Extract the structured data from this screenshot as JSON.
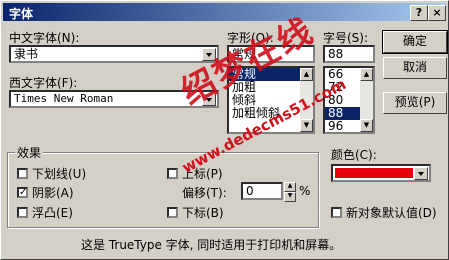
{
  "window": {
    "title": "字体",
    "help_btn": "?",
    "close_btn": "×"
  },
  "chinese_font": {
    "label": "中文字体(N):",
    "value": "隶书"
  },
  "style": {
    "label": "字形(O):",
    "value": "常规",
    "items": [
      "常规",
      "加粗",
      "倾斜",
      "加粗倾斜"
    ],
    "selected": 0
  },
  "size": {
    "label": "字号(S):",
    "value": "88",
    "items": [
      "66",
      "72",
      "80",
      "88",
      "96"
    ],
    "selected": 3
  },
  "western_font": {
    "label": "西文字体(F):",
    "value": "Times New Roman"
  },
  "buttons": {
    "ok": "确定",
    "cancel": "取消",
    "preview": "预览(P)"
  },
  "effects": {
    "label": "效果",
    "underline": "下划线(U)",
    "shadow": "阴影(A)",
    "emboss": "浮凸(E)",
    "superscript": "上标(P)",
    "offset": "偏移(T):",
    "offset_value": "0",
    "offset_unit": "%",
    "subscript": "下标(B)",
    "shadow_checked": "✓"
  },
  "color": {
    "label": "颜色(C):",
    "value": "#e8000c"
  },
  "default_for_new": "新对象默认值(D)",
  "footer": "这是 TrueType 字体, 同时适用于打印机和屏幕。",
  "watermark": {
    "big": "绍梦在线",
    "url": "www.dedecms51.com"
  }
}
